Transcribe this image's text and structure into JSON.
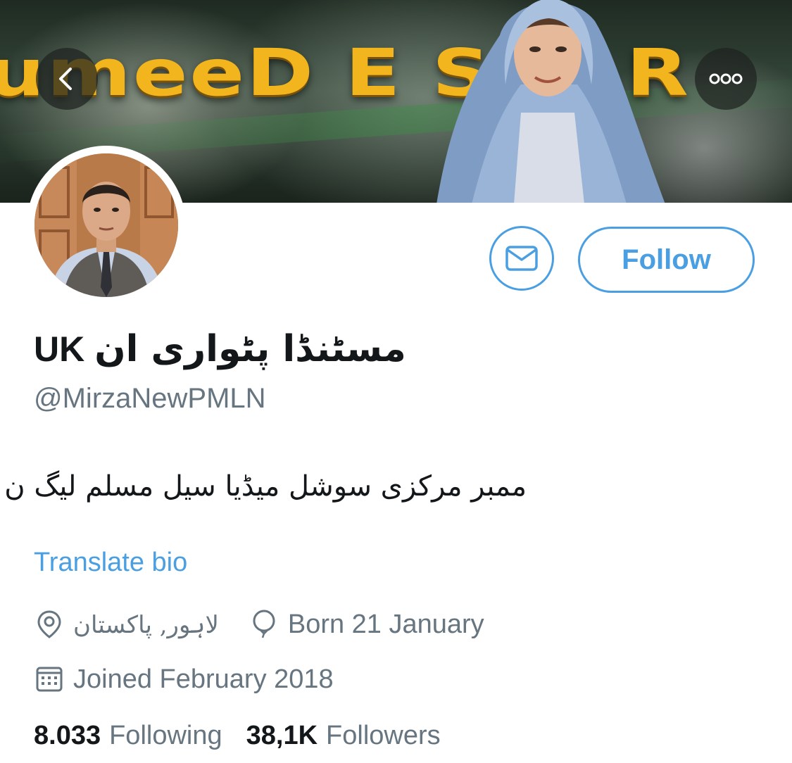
{
  "banner": {
    "title": "umeeD E SHAR",
    "back_icon": "chevron-left-icon",
    "more_icon": "ellipsis-icon",
    "colors": {
      "title": "#f2b51e",
      "button_bg": "#1e2320"
    }
  },
  "profile": {
    "display_name_latin": "UK",
    "display_name_urdu": "مسٹنڈا پٹواری ان",
    "handle": "@MirzaNewPMLN",
    "bio": "ممبر مرکزی سوشل میڈیا سیل مسلم لیگ ن پاکستان",
    "translate_label": "Translate bio",
    "location": "لاہور, پاکستان",
    "birthday": "Born 21 January",
    "joined": "Joined February 2018"
  },
  "actions": {
    "message_icon": "envelope-icon",
    "follow_label": "Follow"
  },
  "stats": {
    "following_count": "8.033",
    "following_label": "Following",
    "followers_count": "38,1K",
    "followers_label": "Followers"
  },
  "colors": {
    "accent": "#4a9fe2",
    "text_primary": "#14171a",
    "text_secondary": "#66757f"
  }
}
